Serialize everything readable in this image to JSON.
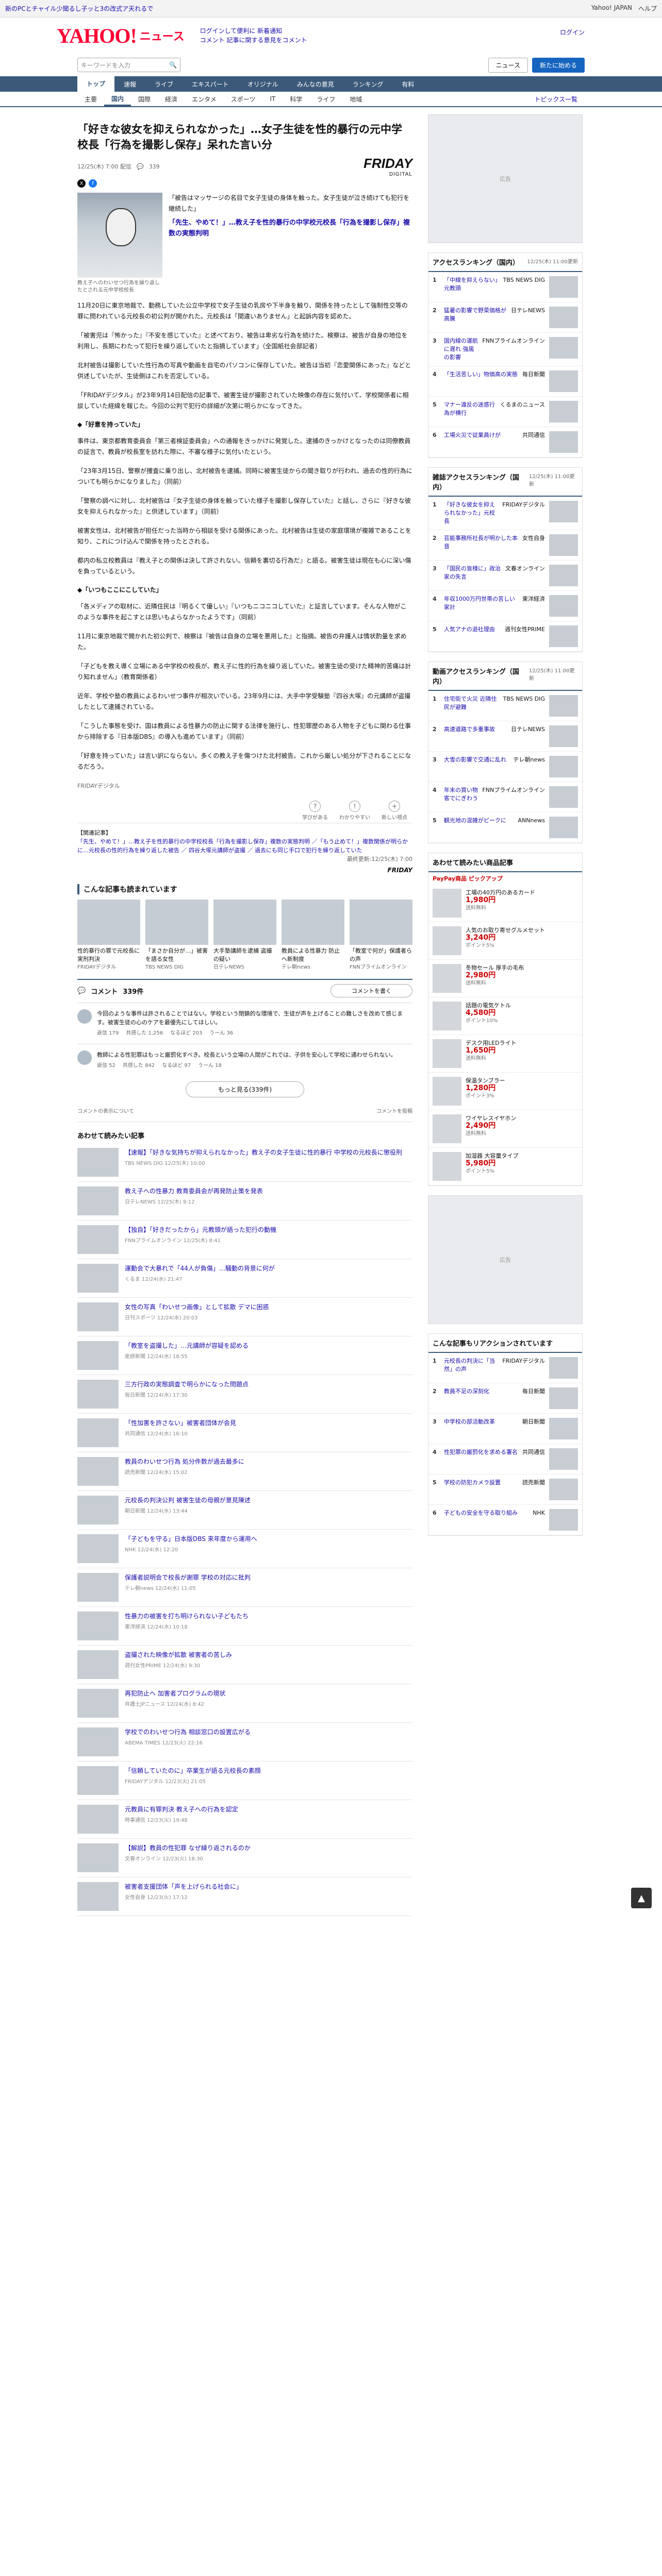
{
  "topbar": {
    "note": "新のPCとチャイル少聞るし子ッと3の改式ア天れるで",
    "yj": "Yahoo! JAPAN",
    "help": "ヘルプ"
  },
  "header": {
    "logo": "YAHOO!",
    "logo_sub": "ニュース",
    "link1": "ログインして便利に 新着通知",
    "link2": "コメント 記事に関する意見をコメント",
    "login": "ログイン",
    "signup": "新規取得"
  },
  "search": {
    "placeholder": "キーワードを入力",
    "btn1": "ニュース",
    "btn2": "新たに始める"
  },
  "nav": [
    "トップ",
    "速報",
    "ライブ",
    "エキスパート",
    "オリジナル",
    "みんなの意見",
    "ランキング",
    "有料"
  ],
  "subnav": [
    "主要",
    "国内",
    "国際",
    "経済",
    "エンタメ",
    "スポーツ",
    "IT",
    "科学",
    "ライフ",
    "地域"
  ],
  "subnav_more": "トピックス一覧",
  "article": {
    "title": "「好きな彼女を抑えられなかった」…女子生徒を性的暴行の元中学校長「行為を撮影し保存」呆れた言い分",
    "date": "12/25(木) 7:00 配信",
    "comments_count": "339",
    "brand": "FRIDAY",
    "brand_sub": "DIGITAL",
    "photo_caption": "教え子へのわいせつ行為を繰り返したとされる元中学校校長",
    "lead_quote": "「先生、やめて！」…教え子を性的暴行の中学校元校長「行為を撮影し保存」複数の実態判明",
    "paras": [
      "「被告はマッサージの名目で女子生徒の身体を触った。女子生徒が泣き続けても犯行を継続した」",
      "11月20日に東京地裁で、勤務していた公立中学校で女子生徒の乳房や下半身を触り、関係を持ったとして強制性交等の罪に問われている元校長の初公判が開かれた。元校長は「間違いありません」と起訴内容を認めた。",
      "「被害児は『怖かった』『不安を感じていた』と述べており、被告は卑劣な行為を続けた。検察は、被告が自身の地位を利用し、長期にわたって犯行を繰り返していたと指摘しています」（全国紙社会部記者）",
      "北村被告は撮影していた性行為の写真や動画を自宅のパソコンに保存していた。被告は当初『恋愛関係にあった』などと供述していたが、生徒側はこれを否定している。",
      "「FRIDAYデジタル」が23年9月14日配信の記事で、被害生徒が撮影されていた映像の存在に気付いて、学校関係者に相談していた経緯を報じた。今回の公判で犯行の詳細が次第に明らかになってきた。"
    ],
    "sec1": "◆「好意を持っていた」",
    "paras2": [
      "事件は、東京都教育委員会「第三者検証委員会」への通報をきっかけに発覚した。逮捕のきっかけとなったのは同僚教員の証言で、教員が校長室を訪れた際に、不審な様子に気付いたという。",
      "「23年3月15日、警察が捜査に乗り出し、北村被告を逮捕。同時に被害生徒からの聞き取りが行われ、過去の性的行為についても明らかになりました」（同前）",
      "「警察の調べに対し、北村被告は『女子生徒の身体を触っていた様子を撮影し保存していた』と話し、さらに『好きな彼女を抑えられなかった』と供述しています」（同前）",
      "被害女性は、北村被告が担任だった当時から相談を受ける関係にあった。北村被告は生徒の家庭環境が複雑であることを知り、これにつけ込んで関係を持ったとされる。",
      "都内の私立校教員は『教え子との関係は決して許されない。信頼を裏切る行為だ』と語る。被害生徒は現在も心に深い傷を負っているという。"
    ],
    "sec2": "◆「いつもここにこしていた」",
    "paras3": [
      "「各メディアの取材に、近隣住民は『明るくて優しい』『いつもニコニコしていた』と証言しています。そんな人物がこのような事件を起こすとは思いもよらなかったようです」（同前）",
      "11月に東京地裁で開かれた初公判で、検察は『被告は自身の立場を悪用した』と指摘。被告の弁護人は情状酌量を求めた。",
      "「子どもを教え導く立場にある中学校の校長が、教え子に性的行為を繰り返していた。被害生徒の受けた精神的苦痛は計り知れません」（教育関係者）",
      "近年、学校や塾の教員によるわいせつ事件が相次いでいる。23年9月には、大手中学受験塾『四谷大塚』の元講師が盗撮したとして逮捕されている。",
      "「こうした事態を受け、国は教員による性暴力の防止に関する法律を施行し、性犯罪歴のある人物を子どもに関わる仕事から排除する『日本版DBS』の導入も進めています」（同前）",
      "「好意を持っていた」は言い訳にならない。多くの教え子を傷つけた北村被告。これから厳しい処分が下されることになるだろう。"
    ],
    "credit": "FRIDAYデジタル",
    "reactions": [
      {
        "icon": "?",
        "label": "学びがある"
      },
      {
        "icon": "!",
        "label": "わかりやすい"
      },
      {
        "icon": "+",
        "label": "新しい視点"
      }
    ],
    "related_head": "【関連記事】",
    "related_text": "「先生、やめて！」…教え子を性的暴行の中学校校長「行為を撮影し保存」複数の実態判明 ／「もう止めて！」複数関係が明らかに…元校長の性的行為を繰り返した被告 ／ 四谷大塚元講師が盗撮 ／ 過去にも同じ手口で犯行を繰り返していた",
    "related_src": "最終更新:12/25(木) 7:00",
    "friday_mark": "FRIDAY"
  },
  "recommend": {
    "title": "こんな記事も読まれています",
    "items": [
      {
        "t": "性的暴行の罪で元校長に実刑判決",
        "s": "FRIDAYデジタル"
      },
      {
        "t": "「まさか自分が…」被害を語る女性",
        "s": "TBS NEWS DIG"
      },
      {
        "t": "大手塾講師を逮捕 盗撮の疑い",
        "s": "日テレNEWS"
      },
      {
        "t": "教員による性暴力 防止へ新制度",
        "s": "テレ朝news"
      },
      {
        "t": "「教室で何が」保護者らの声",
        "s": "FNNプライムオンライン"
      }
    ]
  },
  "comments": {
    "title": "コメント",
    "count": "339件",
    "write": "コメントを書く",
    "items": [
      {
        "body": "今回のような事件は許されることではない。学校という閉鎖的な環境で、生徒が声を上げることの難しさを改めて感じます。被害生徒の心のケアを最優先にしてほしい。",
        "user": "返信 179",
        "acts": [
          "共感した 1,256",
          "なるほど 203",
          "うーん 36"
        ]
      },
      {
        "body": "教師による性犯罪はもっと厳罰化すべき。校長という立場の人間がこれでは、子供を安心して学校に通わせられない。",
        "user": "返信 52",
        "acts": [
          "共感した 842",
          "なるほど 97",
          "うーん 18"
        ]
      }
    ],
    "more": "もっと見る(339件)",
    "foot_left": "コメントの表示について",
    "foot_right": "コメントを投稿"
  },
  "more_list": {
    "title": "あわせて読みたい記事",
    "items": [
      {
        "t": "【速報】「好きな気持ちが抑えられなかった」教え子の女子生徒に性的暴行 中学校の元校長に懲役刑",
        "s": "TBS NEWS DIG 12/25(木) 10:00"
      },
      {
        "t": "教え子への性暴力 教育委員会が再発防止策を発表",
        "s": "日テレNEWS 12/25(木) 9:12"
      },
      {
        "t": "【独自】「好きだったから」元教頭が語った犯行の動機",
        "s": "FNNプライムオンライン 12/25(木) 8:41"
      },
      {
        "t": "運動会で大暴れで「44人が負傷」…騒動の背景に何が",
        "s": "くるま 12/24(水) 21:47"
      },
      {
        "t": "女性の写真「わいせつ画像」として拡散 デマに困惑",
        "s": "日刊スポーツ 12/24(水) 20:03"
      },
      {
        "t": "「教室を盗撮した」…元講師が容疑を認める",
        "s": "産経新聞 12/24(水) 18:55"
      },
      {
        "t": "三方行政の実態調査で明らかになった問題点",
        "s": "毎日新聞 12/24(水) 17:30"
      },
      {
        "t": "「性加害を許さない」被害者団体が会見",
        "s": "共同通信 12/24(水) 16:10"
      },
      {
        "t": "教員のわいせつ行為 処分件数が過去最多に",
        "s": "読売新聞 12/24(水) 15:02"
      },
      {
        "t": "元校長の判決公判 被害生徒の母親が意見陳述",
        "s": "朝日新聞 12/24(水) 13:44"
      },
      {
        "t": "「子どもを守る」日本版DBS 来年度から運用へ",
        "s": "NHK 12/24(水) 12:20"
      },
      {
        "t": "保護者説明会で校長が謝罪 学校の対応に批判",
        "s": "テレ朝news 12/24(水) 11:05"
      },
      {
        "t": "性暴力の被害を打ち明けられない子どもたち",
        "s": "東洋経済 12/24(水) 10:18"
      },
      {
        "t": "盗撮された映像が拡散 被害者の苦しみ",
        "s": "週刊女性PRIME 12/24(水) 9:30"
      },
      {
        "t": "再犯防止へ 加害者プログラムの現状",
        "s": "弁護士JPニュース 12/24(水) 8:42"
      },
      {
        "t": "学校でのわいせつ行為 相談窓口の設置広がる",
        "s": "ABEMA TIMES 12/23(火) 22:16"
      },
      {
        "t": "「信頼していたのに」卒業生が語る元校長の素顔",
        "s": "FRIDAYデジタル 12/23(火) 21:05"
      },
      {
        "t": "元教員に有罪判決 教え子への行為を認定",
        "s": "時事通信 12/23(火) 19:48"
      },
      {
        "t": "【解説】教員の性犯罪 なぜ繰り返されるのか",
        "s": "文春オンライン 12/23(火) 18:30"
      },
      {
        "t": "被害者支援団体「声を上げられる社会に」",
        "s": "女性自身 12/23(火) 17:12"
      }
    ]
  },
  "side": {
    "ad1": "広告",
    "ad2": "広告",
    "rank1": {
      "title": "アクセスランキング（国内）",
      "time": "12/25(木) 11:00更新",
      "items": [
        {
          "t": "「中線を抑えらない」元教頭",
          "s": "TBS NEWS DIG"
        },
        {
          "t": "猛暑の影響で野菜価格が高騰",
          "s": "日テレNEWS"
        },
        {
          "t": "国内線の運航に遅れ 強風の影響",
          "s": "FNNプライムオンライン"
        },
        {
          "t": "「生活苦しい」物価高の実態",
          "s": "毎日新聞"
        },
        {
          "t": "マナー違反の迷惑行為が横行",
          "s": "くるまのニュース"
        },
        {
          "t": "工場火災で従業員けが",
          "s": "共同通信"
        }
      ]
    },
    "rank2": {
      "title": "雑誌アクセスランキング（国内）",
      "time": "12/25(木) 11:00更新",
      "items": [
        {
          "t": "「好きな彼女を抑えられなかった」元校長",
          "s": "FRIDAYデジタル"
        },
        {
          "t": "芸能事務所社長が明かした本音",
          "s": "女性自身"
        },
        {
          "t": "「国民の皆様に」政治家の失言",
          "s": "文春オンライン"
        },
        {
          "t": "年収1000万円世帯の苦しい家計",
          "s": "東洋経済"
        },
        {
          "t": "人気アナの退社理由",
          "s": "週刊女性PRIME"
        }
      ]
    },
    "rank3": {
      "title": "動画アクセスランキング（国内）",
      "time": "12/25(木) 11:00更新",
      "items": [
        {
          "t": "住宅街で火災 近隣住民が避難",
          "s": "TBS NEWS DIG"
        },
        {
          "t": "高速道路で多重事故",
          "s": "日テレNEWS"
        },
        {
          "t": "大雪の影響で交通に乱れ",
          "s": "テレ朝news"
        },
        {
          "t": "年末の買い物客でにぎわう",
          "s": "FNNプライムオンライン"
        },
        {
          "t": "観光地の混雑がピークに",
          "s": "ANNnews"
        }
      ]
    },
    "promo": {
      "title": "あわせて読みたい商品記事",
      "badge": "PayPay商品 ピックアップ",
      "items": [
        {
          "t": "工場の40万円のあるカード",
          "p": "1,980円",
          "s": "送料無料"
        },
        {
          "t": "人気のお取り寄せグルメセット",
          "p": "3,240円",
          "s": "ポイント5%"
        },
        {
          "t": "冬物セール 厚手の毛布",
          "p": "2,980円",
          "s": "送料無料"
        },
        {
          "t": "話題の電気ケトル",
          "p": "4,580円",
          "s": "ポイント10%"
        },
        {
          "t": "デスク用LEDライト",
          "p": "1,650円",
          "s": "送料無料"
        },
        {
          "t": "保温タンブラー",
          "p": "1,280円",
          "s": "ポイント3%"
        },
        {
          "t": "ワイヤレスイヤホン",
          "p": "2,490円",
          "s": "送料無料"
        },
        {
          "t": "加湿器 大容量タイプ",
          "p": "5,980円",
          "s": "ポイント5%"
        }
      ]
    },
    "rank4": {
      "title": "こんな記事もリアクションされています",
      "time": "",
      "items": [
        {
          "t": "元校長の判決に「当然」の声",
          "s": "FRIDAYデジタル"
        },
        {
          "t": "教員不足の深刻化",
          "s": "毎日新聞"
        },
        {
          "t": "中学校の部活動改革",
          "s": "朝日新聞"
        },
        {
          "t": "性犯罪の厳罰化を求める署名",
          "s": "共同通信"
        },
        {
          "t": "学校の防犯カメラ設置",
          "s": "読売新聞"
        },
        {
          "t": "子どもの安全を守る取り組み",
          "s": "NHK"
        }
      ]
    }
  },
  "totop": "▲"
}
